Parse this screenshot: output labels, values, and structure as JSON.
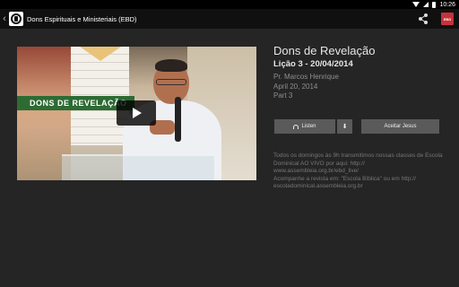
{
  "status_bar": {
    "time": "10:26"
  },
  "action_bar": {
    "back_glyph": "‹",
    "title": "Dons Espirituais e Ministeriais (EBD)",
    "share_icon": "share-icon",
    "avatar_text": "EBD"
  },
  "video": {
    "banner_text": "DONS DE REVELAÇÃO",
    "play_icon": "play-icon"
  },
  "episode": {
    "title": "Dons de Revelação",
    "lesson": "Lição 3 - 20/04/2014",
    "speaker": "Pr. Marcos Henrique",
    "date": "April 20, 2014",
    "part": "Part 3"
  },
  "buttons": {
    "listen_label": "Listen",
    "download_glyph": "⬇",
    "accept_label": "Aceitar Jesus"
  },
  "description": {
    "line1": "Todos os domingos às 9h transmitimos nossas classes de Escola Dominical AO VIVO por aqui: http://",
    "line2": "www.assembleia.org.br/ebd_live/",
    "line3": "Acompanhe a revista em: \"Escola Bíblica\" ou em http://",
    "line4": "escoladominical.assembleia.org.br"
  },
  "colors": {
    "background": "#252525",
    "action_bar": "#101010",
    "button": "#5a5a5a",
    "banner": "#2d6b33",
    "avatar": "#c8313a"
  }
}
